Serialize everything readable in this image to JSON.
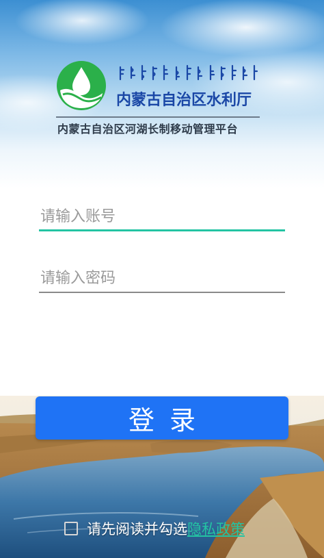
{
  "header": {
    "department_name": "内蒙古自治区水利厅",
    "platform_name": "内蒙古自治区河湖长制移动管理平台",
    "mongolian_script": "ᠥᠪᠥᠷ ᠮᠣᠩᠭᠣᠯ ᠤᠨ ᠤᠰᠤᠨ ᠠᠵᠢᠯ"
  },
  "form": {
    "account_placeholder": "请输入账号",
    "account_value": "",
    "password_placeholder": "请输入密码",
    "password_value": "",
    "login_label": "登录"
  },
  "agreement": {
    "prefix": "请先阅读并勾选",
    "link_label": "隐私政策",
    "checked": false
  },
  "colors": {
    "accent": "#23c4a3",
    "button": "#1f73f5",
    "brand_blue": "#1a47a6",
    "logo_green": "#2bb04a"
  },
  "icons": {
    "logo": "water-drop-logo-icon",
    "checkbox": "checkbox-unchecked-icon"
  }
}
